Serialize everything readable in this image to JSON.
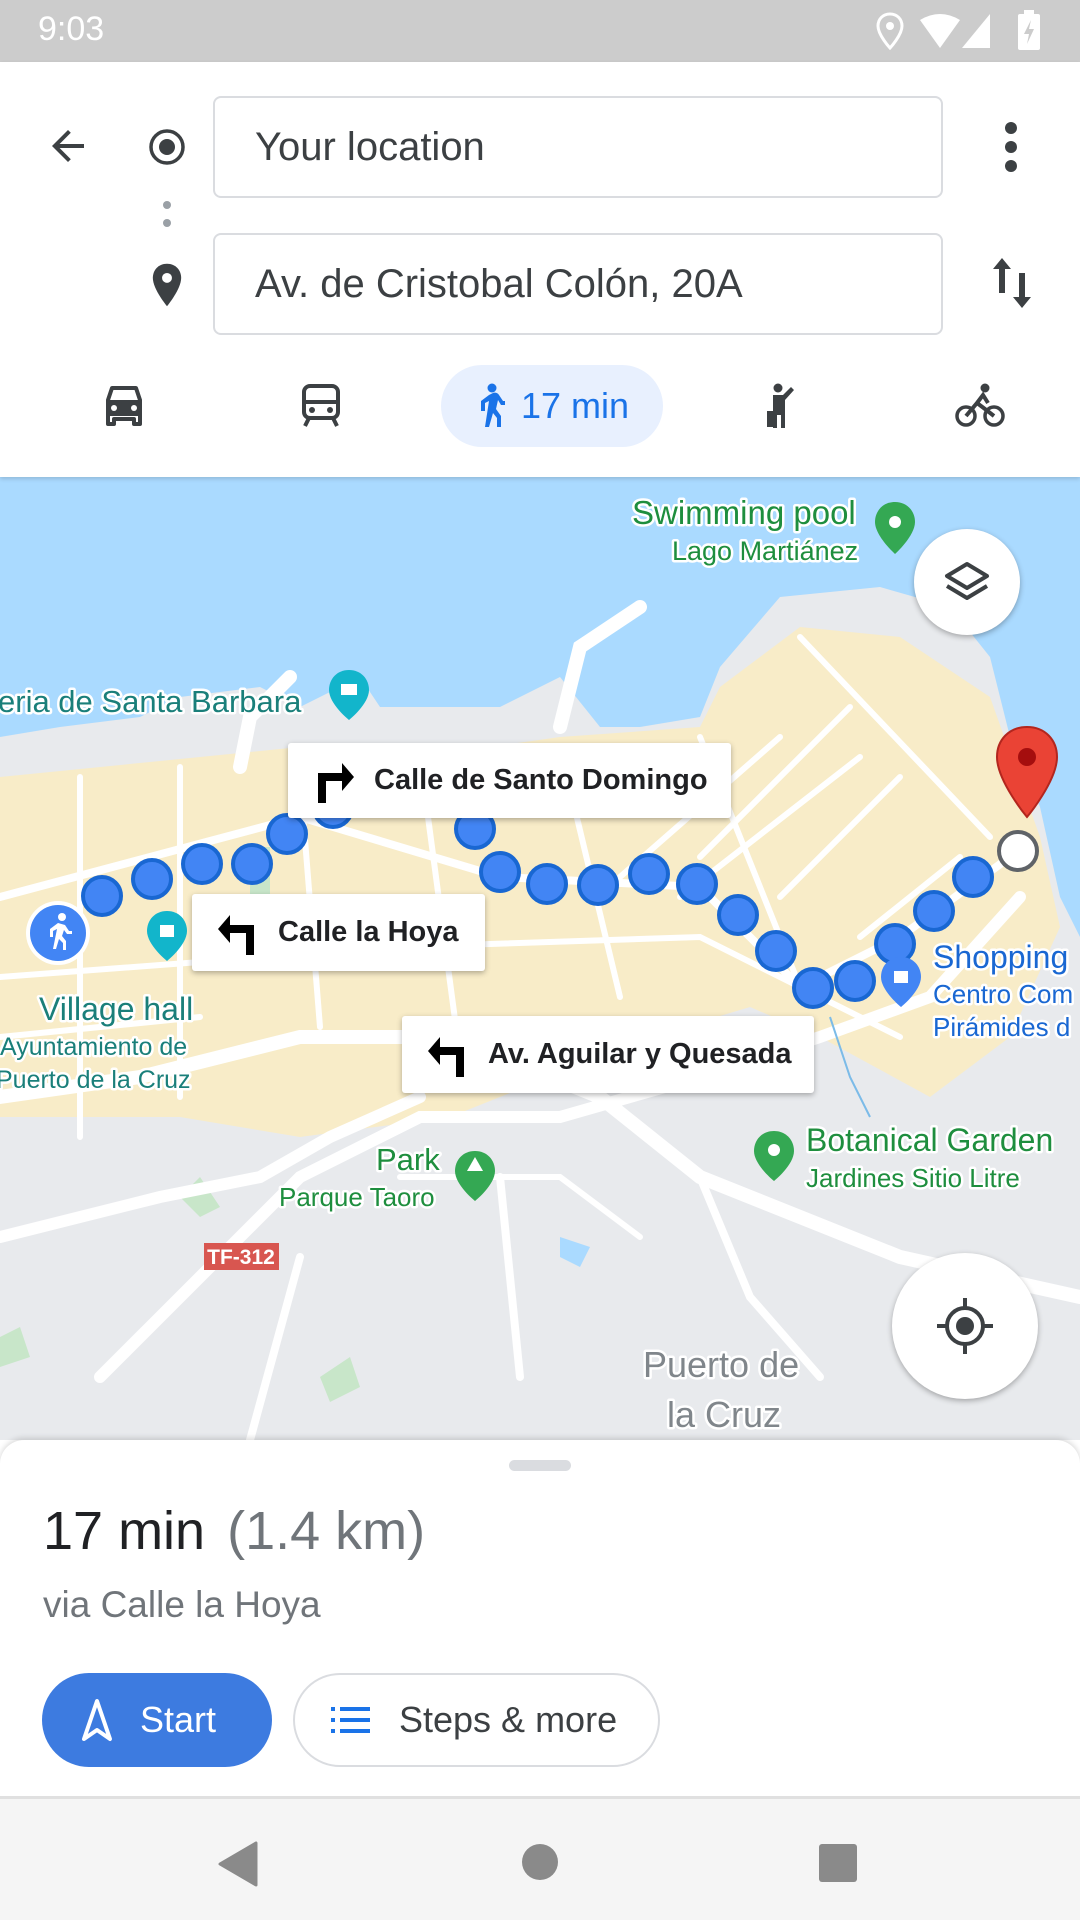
{
  "status_bar": {
    "time": "9:03",
    "icons": [
      "location-icon",
      "wifi-icon",
      "signal-icon",
      "battery-charging-icon"
    ]
  },
  "header": {
    "origin": "Your location",
    "destination": "Av. de Cristobal Colón, 20A",
    "modes": [
      {
        "icon": "car-icon"
      },
      {
        "icon": "bus-icon"
      },
      {
        "icon": "walk-icon",
        "label": "17 min",
        "selected": true
      },
      {
        "icon": "ride-hail-icon"
      },
      {
        "icon": "bike-icon"
      }
    ]
  },
  "map": {
    "labels": {
      "swimming_pool": "Swimming pool",
      "lago": "Lago Martiánez",
      "santa_barbara": "eria de Santa Barbara",
      "village_hall": "Village hall",
      "ayuntamiento_1": "Ayuntamiento de",
      "ayuntamiento_2": "Puerto de la Cruz",
      "park": "Park",
      "parque_taoro": "Parque Taoro",
      "botanical": "Botanical Garden",
      "jardines": "Jardines Sitio Litre",
      "shopping": "Shopping",
      "centro_1": "Centro Com",
      "centro_2": "Pirámides d",
      "road_badge": "TF-312",
      "city_1": "Puerto de",
      "city_2": "la Cruz"
    },
    "callouts": [
      {
        "turn": "right",
        "street": "Calle de Santo Domingo"
      },
      {
        "turn": "left",
        "street": "Calle la Hoya"
      },
      {
        "turn": "left",
        "street": "Av. Aguilar y Quesada"
      }
    ],
    "colors": {
      "route": "#4285f4",
      "water": "#aadaff",
      "destination": "#ea4335"
    }
  },
  "sheet": {
    "duration": "17 min",
    "distance": "(1.4 km)",
    "via": "via Calle la Hoya",
    "start": "Start",
    "steps": "Steps & more",
    "accent": "#3d7be0"
  }
}
